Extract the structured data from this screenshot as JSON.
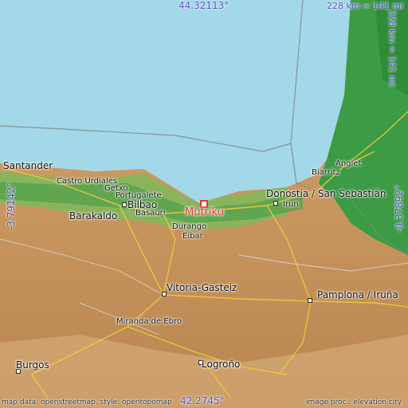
{
  "map": {
    "coords": {
      "north": "44.32113°",
      "south": "42.2745°",
      "west": "-3.79142°",
      "east": "-0.37892°"
    },
    "scale": {
      "horizontal": "228 km = 141 mi",
      "vertical": "228 km = 141 mi"
    },
    "focus_place": "Mutriku",
    "places": [
      "Santander",
      "Castro Urdiales",
      "Getxo",
      "Portugalete",
      "Bilbao",
      "Barakaldo",
      "Basauri",
      "Durango",
      "Eibar",
      "Donostia / San Sebastián",
      "Irun",
      "Biarritz",
      "Anglet",
      "Vitoria-Gasteiz",
      "Pamplona / Iruña",
      "Miranda de Ebro",
      "Logroño",
      "Burgos"
    ],
    "attribution_left": "map data: openstreetmap, style: opentopomap",
    "attribution_right": "image proc.: elevation.city",
    "colors": {
      "sea": "#a3d8e8",
      "lowland": "#3c9b45",
      "terrain": "#c89a66",
      "marker": "#e8322f",
      "coordinate_text": "#4f52d6"
    }
  }
}
